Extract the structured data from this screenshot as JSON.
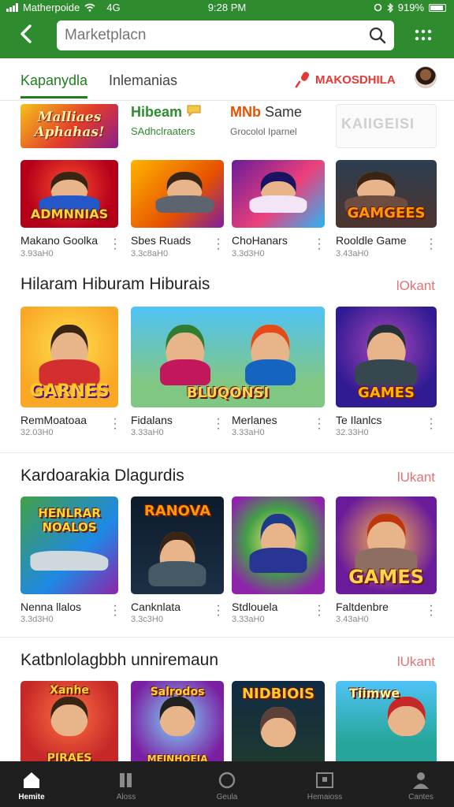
{
  "status": {
    "carrier": "Matherpoide",
    "center_glyph": "4G",
    "time": "9:28 PM",
    "battery": "919%"
  },
  "search": {
    "placeholder": "Marketplacn"
  },
  "tabs": {
    "active": "Kapanydla",
    "other": "Inlemanias",
    "promo": "MAKOSDHILA"
  },
  "strip": {
    "chip1": "Malliaes Aphahas!",
    "brand_title": "Hibeam",
    "brand_sub": "SAdhclraaters",
    "brand2_prefix": "MNb",
    "brand2_title": "Same",
    "brand2_sub": "Grocolol Iparnel",
    "grey_chip": "KAIIGEISI"
  },
  "row0": [
    {
      "name": "Makano Goolka",
      "meta": "3.93aH0",
      "logo": "ADMNNIAS"
    },
    {
      "name": "Sbes Ruads",
      "meta": "3.3c8aH0",
      "logo": ""
    },
    {
      "name": "ChoHanars",
      "meta": "3.3d3H0",
      "logo": ""
    },
    {
      "name": "Rooldle Game",
      "meta": "3.43aH0",
      "logo": "GAMGEES"
    }
  ],
  "section1": {
    "title": "Hilaram Hiburam Hiburais",
    "more": "lOkant",
    "cards": [
      {
        "name": "RemMoatoaa",
        "meta": "32.03H0",
        "logo": "GARNES"
      },
      {
        "name": "Fidalans",
        "meta": "3.33aH0",
        "logo": "BLUQONSI"
      },
      {
        "name": "Merlanes",
        "meta": "3.33aH0",
        "logo": ""
      },
      {
        "name": "Te Ilanlcs",
        "meta": "32.33H0",
        "logo": "GAMES"
      }
    ]
  },
  "section2": {
    "title": "Kardoarakia Dlagurdis",
    "more": "lUkant",
    "cards": [
      {
        "name": "Nenna llalos",
        "meta": "3.3d3H0",
        "logo": "HENLRAR NOALOS"
      },
      {
        "name": "Canknlata",
        "meta": "3.3c3H0",
        "logo": "RANOVA"
      },
      {
        "name": "Stdlouela",
        "meta": "3.33aH0",
        "logo": ""
      },
      {
        "name": "Faltdenbre",
        "meta": "3.43aH0",
        "logo": "GAMES"
      }
    ]
  },
  "section3": {
    "title": "Katbnlolagbbh unniremaun",
    "more": "lUkant",
    "cards": [
      {
        "logo": "PIRAES",
        "top": "Xanhe"
      },
      {
        "logo": "MEINHOEIA",
        "top": "Salrodos"
      },
      {
        "logo": "",
        "top": "NIDBIOIS"
      },
      {
        "logo": "",
        "top": "Tiimwe"
      }
    ]
  },
  "bottom_nav": [
    {
      "label": "Hemite",
      "icon": "home-icon"
    },
    {
      "label": "Aloss",
      "icon": "library-icon"
    },
    {
      "label": "Geula",
      "icon": "search-circle-icon"
    },
    {
      "label": "Hemaioss",
      "icon": "news-icon"
    },
    {
      "label": "Cantes",
      "icon": "profile-icon"
    }
  ]
}
